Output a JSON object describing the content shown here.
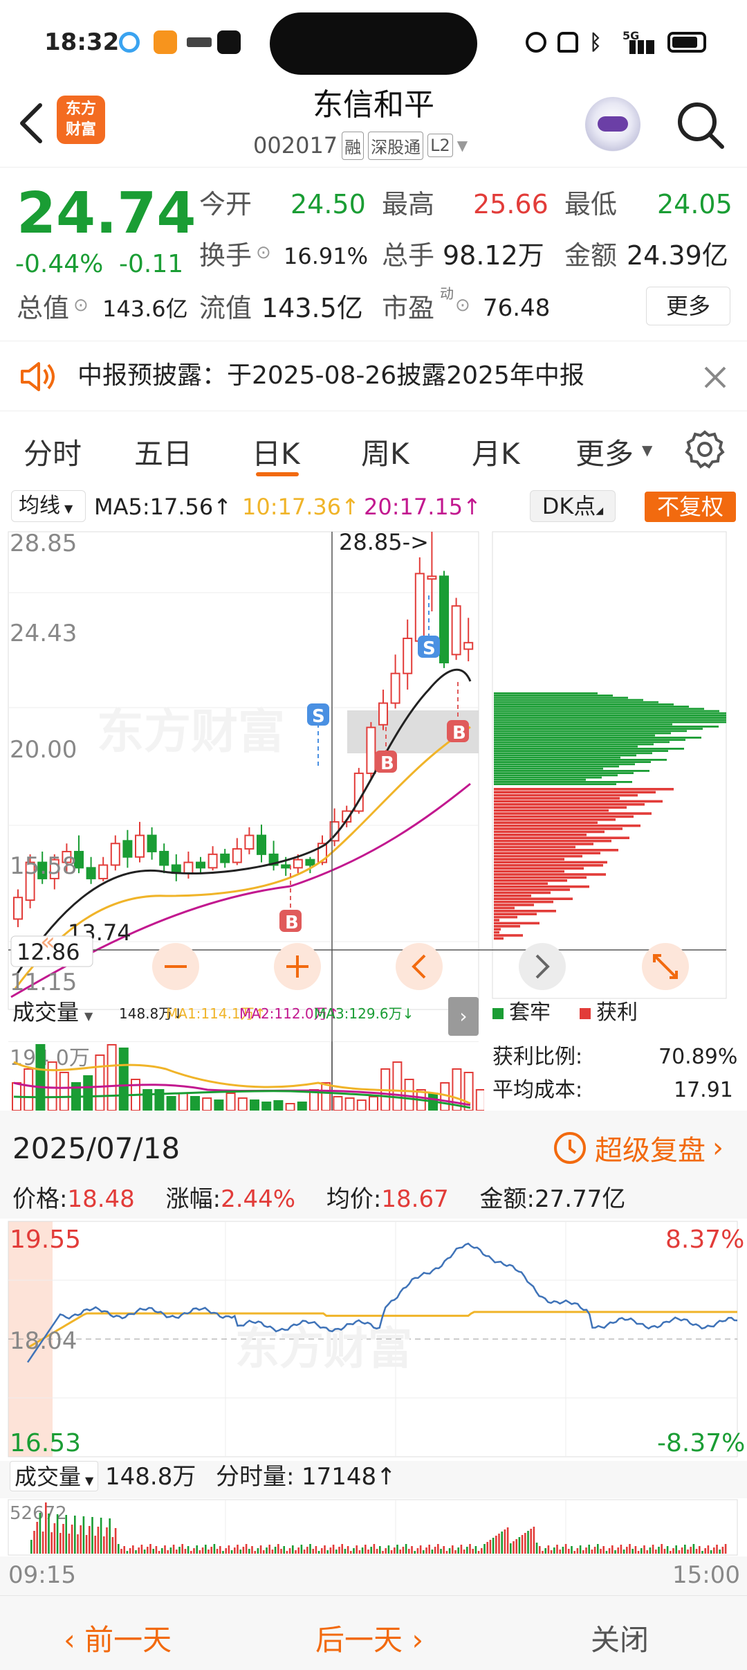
{
  "status": {
    "time": "18:32",
    "network": "5G"
  },
  "header": {
    "brand_logo": "东方\n财富",
    "title": "东信和平",
    "code": "002017",
    "tag_rong": "融",
    "tag_sgt": "深股通",
    "tag_l2": "L2"
  },
  "quote": {
    "price": "24.74",
    "change_pct": "-0.44%",
    "change": "-0.11",
    "open_label": "今开",
    "open": "24.50",
    "high_label": "最高",
    "high": "25.66",
    "low_label": "最低",
    "low": "24.05",
    "turnover_label": "换手",
    "turnover": "16.91%",
    "volume_label": "总手",
    "volume": "98.12万",
    "amount_label": "金额",
    "amount": "24.39亿",
    "mcap_label": "总值",
    "mcap": "143.6亿",
    "float_label": "流值",
    "float": "143.5亿",
    "pe_label": "市盈",
    "pe_sup": "动",
    "pe": "76.48",
    "more_btn": "更多"
  },
  "notice": {
    "text": "中报预披露：于2025-08-26披露2025年中报"
  },
  "tabs": {
    "items": [
      "分时",
      "五日",
      "日K",
      "周K",
      "月K",
      "更多"
    ],
    "active": "日K"
  },
  "kchart": {
    "ma_select": "均线",
    "ma5": "MA5:17.56↑",
    "ma10": "10:17.36↑",
    "ma20": "20:17.15↑",
    "dk": "DK点",
    "fq": "不复权",
    "y_labels": [
      "28.85",
      "24.43",
      "20.00",
      "15.58",
      "11.15"
    ],
    "max_marker": "28.85->",
    "min_label": "13.74",
    "cursor_price": "12.86",
    "signals": [
      "S",
      "S",
      "B",
      "B",
      "B"
    ],
    "watermark": "东方财富"
  },
  "volume": {
    "select": "成交量",
    "v": "148.8万↓",
    "ma1": "MA1:114.1万↑",
    "ma2": "MA2:112.0万↑",
    "ma3": "MA3:129.6万↓",
    "y_label": "194.0万"
  },
  "cost": {
    "legend_trap": "套牢",
    "legend_profit": "获利",
    "ratio_label": "获利比例:",
    "ratio": "70.89%",
    "avg_label": "平均成本:",
    "avg": "17.91"
  },
  "minute": {
    "date": "2025/07/18",
    "replay": "超级复盘",
    "price_label": "价格:",
    "price": "18.48",
    "chg_label": "涨幅:",
    "chg": "2.44%",
    "avg_label": "均价:",
    "avg": "18.67",
    "amount_label": "金额:",
    "amount": "27.77亿",
    "ytop": "19.55",
    "ymid": "18.04",
    "ybot": "16.53",
    "ptop": "8.37%",
    "pbot": "-8.37%",
    "vol_select": "成交量",
    "vol": "148.8万",
    "tick_label": "分时量:",
    "tick": "17148↑",
    "vol_max": "52672",
    "time_start": "09:15",
    "time_end": "15:00"
  },
  "bottom": {
    "prev": "前一天",
    "next": "后一天",
    "close": "关闭"
  },
  "colors": {
    "up": "#e23c39",
    "down": "#1a9d34",
    "accent": "#f26a0f",
    "blue": "#4a90e2"
  }
}
